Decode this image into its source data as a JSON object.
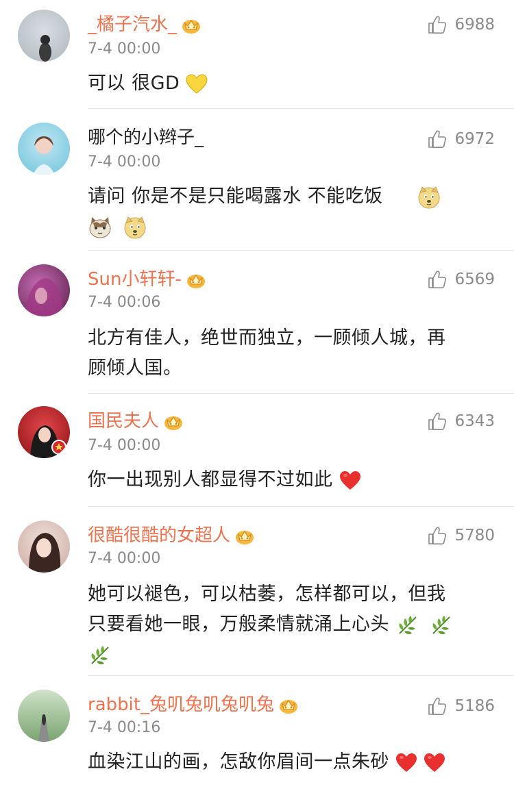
{
  "comments": [
    {
      "name": "_橘子汽水_",
      "time": "7-4 00:00",
      "likes": "6988",
      "text": "可以 很GD",
      "vip": true
    },
    {
      "name": "哪个的小辫子_",
      "time": "7-4 00:00",
      "likes": "6972",
      "text": "请问 你是不是只能喝露水 不能吃饭",
      "vip": false
    },
    {
      "name": "Sun小轩轩-",
      "time": "7-4 00:06",
      "likes": "6569",
      "text_line1": "北方有佳人，绝世而独立，一顾倾人城，再",
      "text_line2": "顾倾人国。",
      "vip": true
    },
    {
      "name": "国民夫人",
      "time": "7-4 00:00",
      "likes": "6343",
      "text": "你一出现别人都显得不过如此",
      "vip": true
    },
    {
      "name": "很酷很酷的女超人",
      "time": "7-4 00:00",
      "likes": "5780",
      "text_line1": "她可以褪色，可以枯萎，怎样都可以，但我",
      "text_line2": "只要看她一眼，万般柔情就涌上心头",
      "vip": true
    },
    {
      "name": "rabbit_兔叽兔叽兔叽兔",
      "time": "7-4 00:16",
      "likes": "5186",
      "text": "血染江山的画，怎敌你眉间一点朱砂",
      "vip": true
    }
  ],
  "icons": {
    "like": "thumbs-up-icon",
    "vip": "crown-icon",
    "heart": "heart-emoji",
    "yellow_heart": "yellow-heart-emoji",
    "doge": "doge-emoji",
    "cat": "cat-emoji",
    "leaf": "leaf-emoji"
  },
  "colors": {
    "vip_name": "#eb7350",
    "meta": "#8a8a8a",
    "divider": "#e6e6e6"
  }
}
